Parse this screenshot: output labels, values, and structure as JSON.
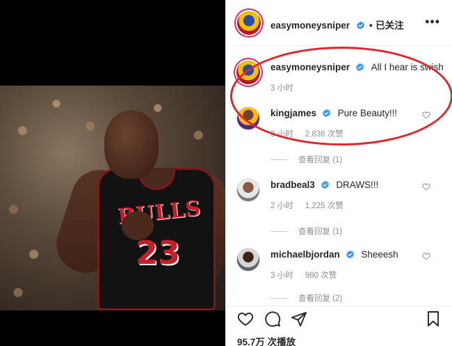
{
  "post": {
    "author": "easymoneysniper",
    "follow_status": "已关注",
    "views": "95.7万 次播放"
  },
  "caption": {
    "user": "easymoneysniper",
    "text": "All I hear is swish",
    "time": "3 小时"
  },
  "comments": [
    {
      "user": "kingjames",
      "text": "Pure Beauty!!!",
      "time": "3 小时",
      "likes": "2,836 次赞",
      "replies": "查看回复 (1)"
    },
    {
      "user": "bradbeal3",
      "text": "DRAWS!!!",
      "time": "2 小时",
      "likes": "1,225 次赞",
      "replies": "查看回复 (1)"
    },
    {
      "user": "michaelbjordan",
      "text": "Sheeesh",
      "time": "3 小时",
      "likes": "980 次赞",
      "replies": "查看回复 (2)"
    }
  ],
  "video": {
    "jersey_team": "BULLS",
    "jersey_number": "23"
  },
  "icons": [
    "verified-badge-icon",
    "more-options-icon",
    "heart-icon",
    "comment-icon",
    "share-icon",
    "bookmark-icon"
  ],
  "colors": {
    "verified": "#3897f0",
    "annotation": "#e2232a",
    "muted_text": "#8e8e8e"
  }
}
